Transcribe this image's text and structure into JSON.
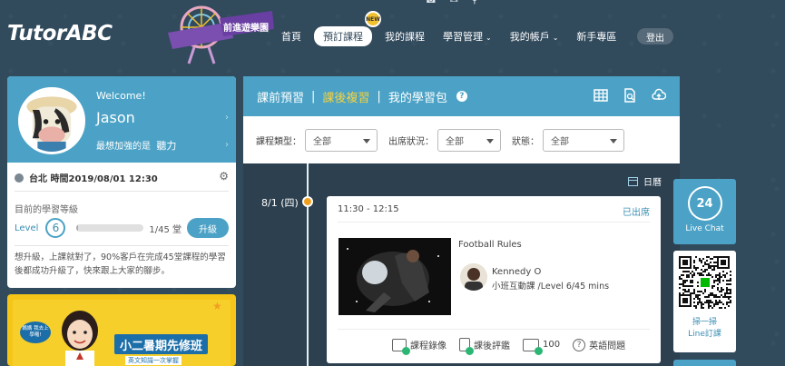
{
  "header": {
    "logo": "TutorABC",
    "promo_badge": "前進遊樂園",
    "new_badge": "NEW",
    "nav": [
      {
        "label": "首頁",
        "active": false,
        "dropdown": false
      },
      {
        "label": "預訂課程",
        "active": true,
        "dropdown": false
      },
      {
        "label": "我的課程",
        "active": false,
        "dropdown": false
      },
      {
        "label": "學習管理",
        "active": false,
        "dropdown": true
      },
      {
        "label": "我的帳戶",
        "active": false,
        "dropdown": true
      },
      {
        "label": "新手專區",
        "active": false,
        "dropdown": false
      }
    ],
    "logout": "登出"
  },
  "profile": {
    "welcome": "Welcome!",
    "name": "Jason",
    "focus_label": "最想加強的是",
    "focus_value": "聽力",
    "time": "台北 時間2019/08/01 12:30",
    "level_title": "目前的學習等級",
    "level_label": "Level",
    "level_value": "6",
    "progress": "1/45 堂",
    "progress_fraction": 0.022,
    "upgrade": "升級",
    "promo_text": "想升級，上課就對了，90%客戶在完成45堂課程的學習後都成功升級了，快來跟上大家的腳步。"
  },
  "banner": {
    "bubble": "媽媽 我去上學囉!",
    "title": "小二暑期先修班",
    "subtitle": "英文知識一次掌握"
  },
  "main": {
    "tabs": [
      {
        "label": "課前預習",
        "active": false
      },
      {
        "label": "課後複習",
        "active": true
      },
      {
        "label": "我的學習包",
        "active": false
      }
    ],
    "filters": [
      {
        "label": "課程類型：",
        "value": "全部"
      },
      {
        "label": "出席狀況：",
        "value": "全部"
      },
      {
        "label": "狀態：",
        "value": "全部"
      }
    ],
    "calendar_link": "日曆",
    "date": "8/1 (四)",
    "class": {
      "time": "11:30 - 12:15",
      "status": "已出席",
      "course_title": "Football Rules",
      "teacher": "Kennedy O",
      "info": "小班互動課 /Level 6/45 mins",
      "actions": {
        "recording": "課程錄像",
        "review": "課後評鑑",
        "vocab_count": "100",
        "questions": "英語問題"
      }
    }
  },
  "side": {
    "live_chat_number": "24",
    "live_chat": "Live Chat",
    "qr_line1": "掃一掃",
    "qr_line2": "Line訂課"
  }
}
